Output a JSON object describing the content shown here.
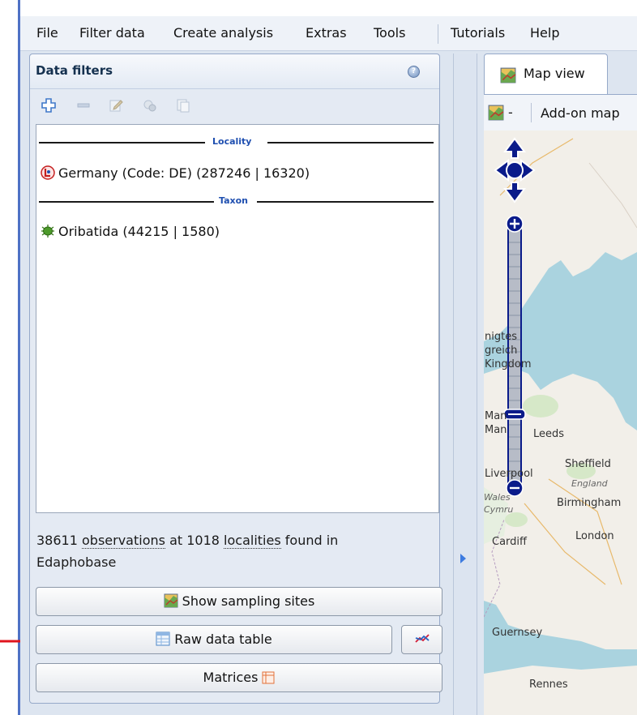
{
  "menu": [
    "File",
    "Filter data",
    "Create analysis",
    "Extras",
    "Tools",
    "Tutorials",
    "Help"
  ],
  "left_panel": {
    "title": "Data filters",
    "sections": [
      {
        "label": "Locality",
        "entry": "Germany (Code: DE) (287246 | 16320)"
      },
      {
        "label": "Taxon",
        "entry": "Oribatida (44215 | 1580)"
      }
    ],
    "summary": {
      "count_obs": "38611",
      "obs_word": "observations",
      "at_text": "at 1018",
      "loc_word": "localities",
      "found_text": "found in",
      "source": "Edaphobase"
    },
    "buttons": {
      "show_sites": "Show sampling sites",
      "raw_table": "Raw data table",
      "matrices": "Matrices"
    }
  },
  "right_panel": {
    "tab_label": "Map view",
    "map_toolbar_dropdown": "-",
    "addon_label": "Add-on map",
    "map_labels": {
      "uk1": "nigtes",
      "uk2": "greich",
      "uk3": "Kingdom",
      "man1": "Man",
      "man2": "Man",
      "leeds": "Leeds",
      "sheffield": "Sheffield",
      "liverpool": "Liverpool",
      "england": "England",
      "wales": "Wales",
      "cymru": "Cymru",
      "birmingham": "Birmingham",
      "cardiff": "Cardiff",
      "london": "London",
      "guernsey": "Guernsey",
      "rennes": "Rennes"
    }
  },
  "colors": {
    "accent_blue": "#1f4fb0",
    "map_nav_blue": "#0a1b8a",
    "arrow_red": "#e0141e"
  }
}
